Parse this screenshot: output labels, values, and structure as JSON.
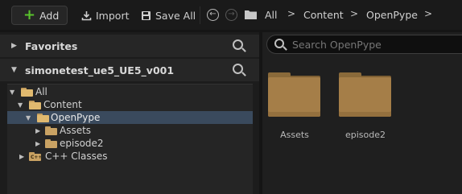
{
  "toolbar": {
    "add_label": "Add",
    "import_label": "Import",
    "save_all_label": "Save All",
    "back_symbol": "←",
    "forward_symbol": "→",
    "breadcrumbs": [
      "All",
      "Content",
      "OpenPype"
    ],
    "chevron": ">"
  },
  "sidebar": {
    "favorites_label": "Favorites",
    "project_label": "simonetest_ue5_UE5_v001",
    "tree": [
      {
        "label": "All",
        "expanded": true,
        "selected": false
      },
      {
        "label": "Content",
        "expanded": true,
        "selected": false
      },
      {
        "label": "OpenPype",
        "expanded": true,
        "selected": true
      },
      {
        "label": "Assets",
        "expanded": false,
        "selected": false
      },
      {
        "label": "episode2",
        "expanded": false,
        "selected": false
      },
      {
        "label": "C++ Classes",
        "expanded": false,
        "selected": false
      }
    ]
  },
  "content": {
    "search_placeholder": "Search OpenPype",
    "folders": [
      "Assets",
      "episode2"
    ]
  },
  "icons": {
    "add": "plus-icon",
    "import": "import-icon",
    "save_all": "save-icon",
    "search": "search-icon",
    "folder": "folder-icon"
  },
  "colors": {
    "accent_green": "#59c32c",
    "selection": "#3a4a5d",
    "folder": "#c9a263"
  }
}
